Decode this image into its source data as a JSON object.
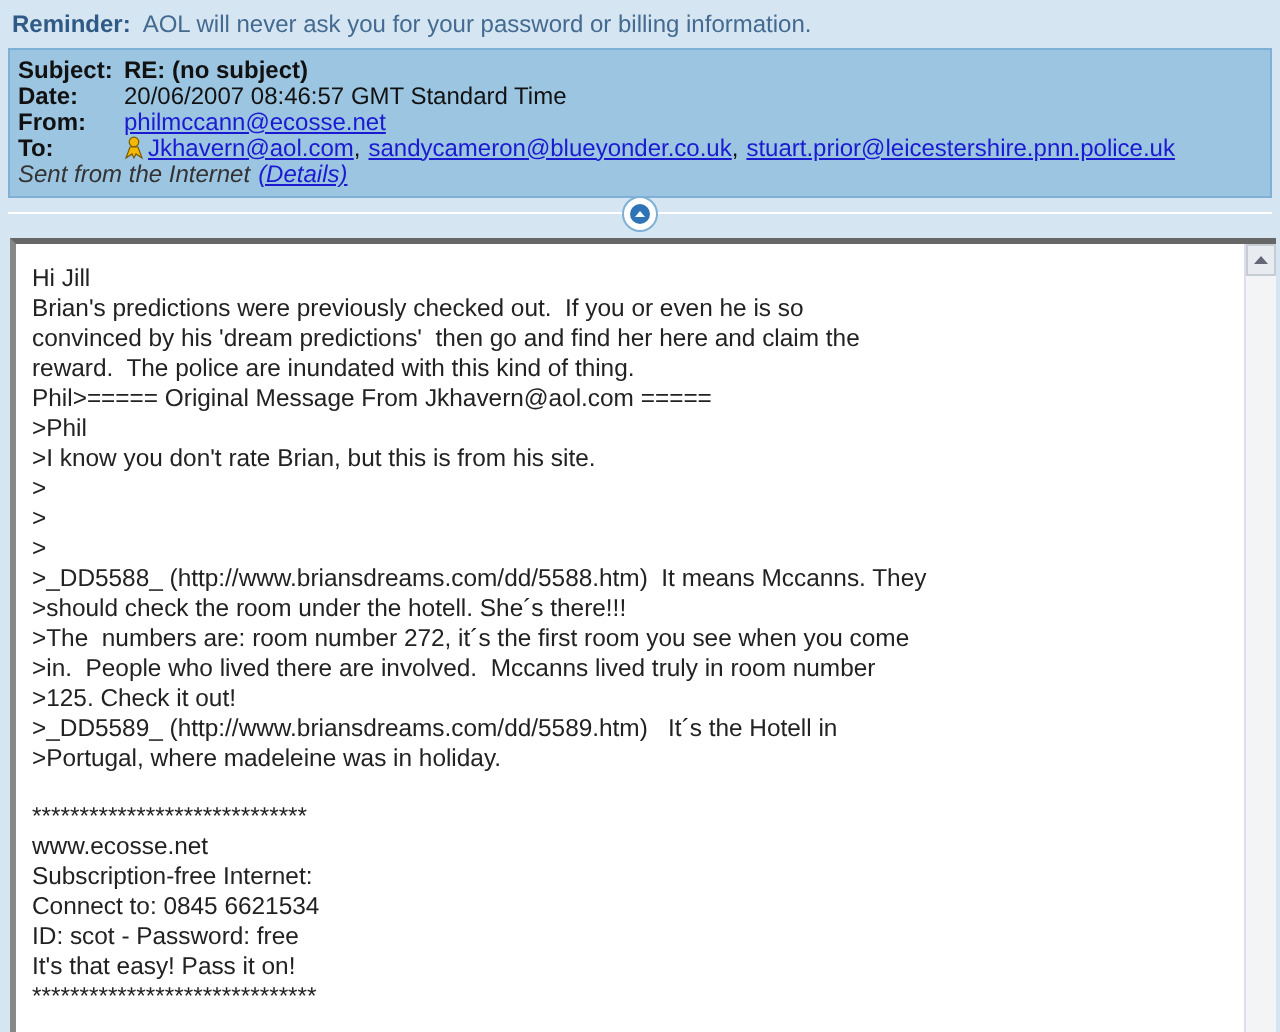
{
  "reminder": {
    "label": "Reminder:",
    "text": "AOL will never ask you for your password or billing information."
  },
  "header": {
    "fields": [
      {
        "kind": "text",
        "label": "Subject:",
        "value": "RE: (no subject)",
        "bold": true
      },
      {
        "kind": "text",
        "label": "Date:",
        "value": "20/06/2007 08:46:57 GMT Standard Time",
        "bold": false
      },
      {
        "kind": "links",
        "label": "From:",
        "links": [
          {
            "address": "philmccann@ecosse.net",
            "buddy": false
          }
        ]
      },
      {
        "kind": "links",
        "label": "To:",
        "links": [
          {
            "address": "Jkhavern@aol.com",
            "buddy": true,
            "separator": ","
          },
          {
            "address": "sandycameron@blueyonder.co.uk",
            "buddy": false,
            "separator": ","
          },
          {
            "address": "stuart.prior@leicestershire.pnn.police.uk",
            "buddy": false
          }
        ]
      }
    ],
    "sent_from": "Sent from the Internet",
    "details_link": "(Details)"
  },
  "body": {
    "paragraphs": [
      [
        "Hi Jill",
        "Brian's predictions were previously checked out.  If you or even he is so",
        "convinced by his 'dream predictions'  then go and find her here and claim the",
        "reward.  The police are inundated with this kind of thing.",
        "Phil>===== Original Message From Jkhavern@aol.com =====",
        ">Phil",
        ">I know you don't rate Brian, but this is from his site.",
        ">",
        ">",
        ">",
        ">_DD5588_ (http://www.briansdreams.com/dd/5588.htm)  It means Mccanns. They",
        ">should check the room under the hotell. She´s there!!!",
        ">The  numbers are: room number 272, it´s the first room you see when you come",
        ">in.  People who lived there are involved.  Mccanns lived truly in room number",
        ">125. Check it out!",
        ">_DD5589_ (http://www.briansdreams.com/dd/5589.htm)   It´s the Hotell in",
        ">Portugal, where madeleine was in holiday."
      ],
      [
        "*****************************",
        "www.ecosse.net",
        "Subscription-free Internet:",
        "Connect to: 0845 6621534",
        "ID: scot - Password: free",
        "It's that easy! Pass it on!",
        "******************************"
      ]
    ]
  }
}
